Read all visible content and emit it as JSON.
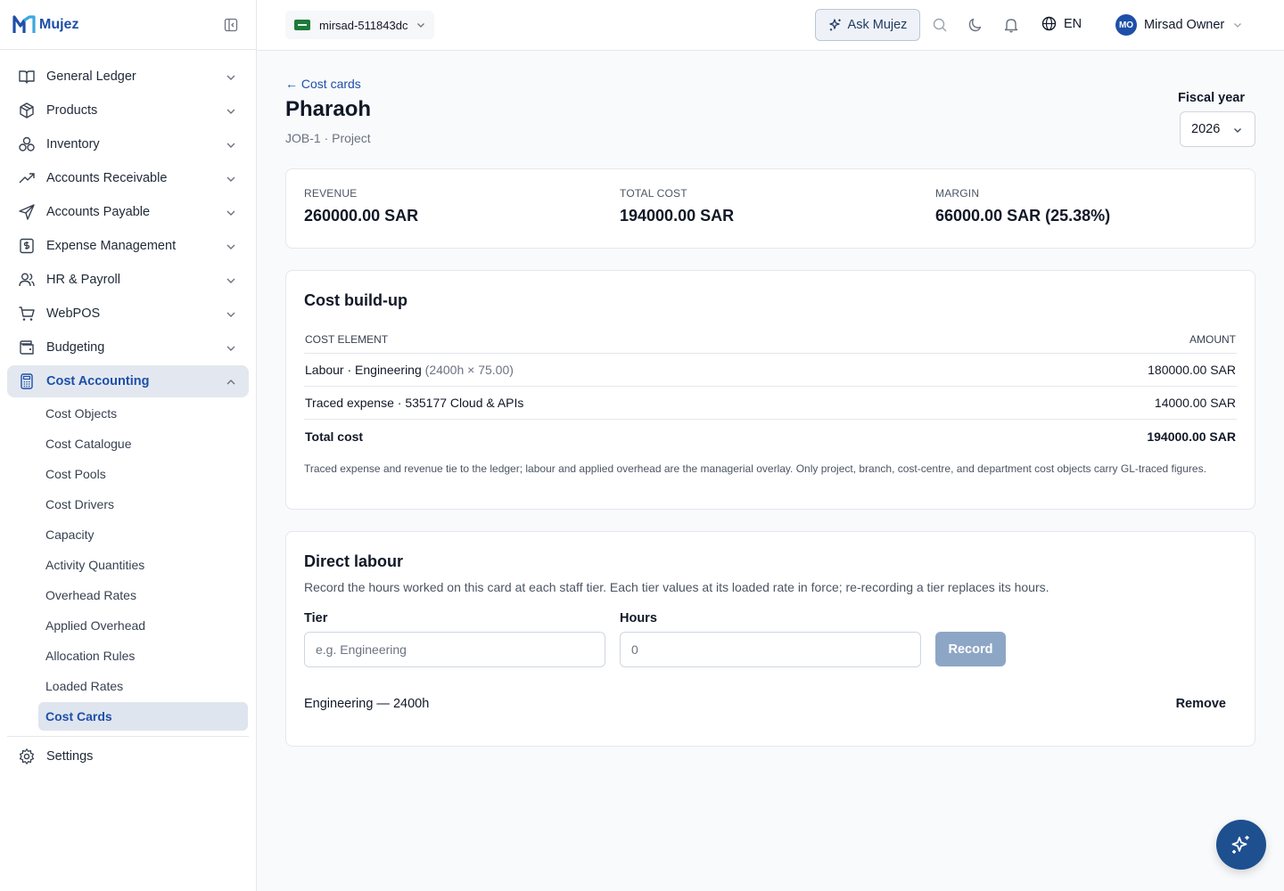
{
  "brand": {
    "name": "Mujez"
  },
  "sidebar": {
    "items": [
      {
        "label": "General Ledger",
        "icon": "book-icon"
      },
      {
        "label": "Products",
        "icon": "box-icon"
      },
      {
        "label": "Inventory",
        "icon": "boxes-icon"
      },
      {
        "label": "Accounts Receivable",
        "icon": "trend-up-icon"
      },
      {
        "label": "Accounts Payable",
        "icon": "send-icon"
      },
      {
        "label": "Expense Management",
        "icon": "receipt-icon"
      },
      {
        "label": "HR & Payroll",
        "icon": "users-icon"
      },
      {
        "label": "WebPOS",
        "icon": "cart-icon"
      },
      {
        "label": "Budgeting",
        "icon": "wallet-icon"
      },
      {
        "label": "Cost Accounting",
        "icon": "calculator-icon"
      }
    ],
    "sub_items": [
      "Cost Objects",
      "Cost Catalogue",
      "Cost Pools",
      "Cost Drivers",
      "Capacity",
      "Activity Quantities",
      "Overhead Rates",
      "Applied Overhead",
      "Allocation Rules",
      "Loaded Rates",
      "Cost Cards"
    ],
    "settings_label": "Settings"
  },
  "topbar": {
    "tenant": "mirsad-511843dc",
    "ask_label": "Ask Mujez",
    "lang": "EN",
    "user_initials": "MO",
    "user_name": "Mirsad Owner"
  },
  "page": {
    "back_label": "← Cost cards",
    "title": "Pharaoh",
    "subtitle": "JOB-1 · Project",
    "fiscal_year_label": "Fiscal year",
    "fiscal_year": "2026"
  },
  "kpis": [
    {
      "label": "REVENUE",
      "value": "260000.00 SAR"
    },
    {
      "label": "TOTAL COST",
      "value": "194000.00 SAR"
    },
    {
      "label": "MARGIN",
      "value": "66000.00 SAR (25.38%)"
    }
  ],
  "cost_buildup": {
    "title": "Cost build-up",
    "col_element": "COST ELEMENT",
    "col_amount": "AMOUNT",
    "rows": [
      {
        "element": "Labour · Engineering",
        "detail": "(2400h × 75.00)",
        "amount": "180000.00 SAR"
      },
      {
        "element": "Traced expense · 535177 Cloud & APIs",
        "detail": "",
        "amount": "14000.00 SAR"
      }
    ],
    "total_label": "Total cost",
    "total_amount": "194000.00 SAR",
    "note": "Traced expense and revenue tie to the ledger; labour and applied overhead are the managerial overlay. Only project, branch, cost-centre, and department cost objects carry GL-traced figures."
  },
  "direct_labour": {
    "title": "Direct labour",
    "description": "Record the hours worked on this card at each staff tier. Each tier values at its loaded rate in force; re-recording a tier replaces its hours.",
    "tier_label": "Tier",
    "tier_placeholder": "e.g. Engineering",
    "hours_label": "Hours",
    "hours_placeholder": "0",
    "record_label": "Record",
    "entries": [
      {
        "text": "Engineering — 2400h",
        "remove_label": "Remove"
      }
    ]
  },
  "colors": {
    "accent": "#1e4fa8",
    "fab": "#1e4f8f",
    "record_button": "#8ea6c6"
  }
}
